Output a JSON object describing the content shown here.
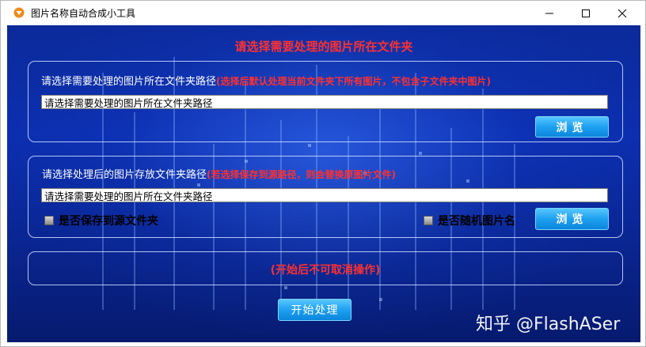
{
  "window": {
    "title": "图片名称自动合成小工具",
    "minimize_icon": "minimize-icon",
    "maximize_icon": "maximize-icon",
    "close_icon": "close-icon"
  },
  "header": {
    "title": "请选择需要处理的图片所在文件夹"
  },
  "source_group": {
    "label": "请选择需要处理的图片所在文件夹路径",
    "hint": "(选择后默认处理当前文件夹下所有图片，不包含子文件夹中图片)",
    "input_value": "请选择需要处理的图片所在文件夹路径",
    "browse_label": "浏览"
  },
  "output_group": {
    "label": "请选择处理后的图片存放文件夹路径",
    "hint": "(若选择保存到源路径，则会替换原图片文件)",
    "input_value": "请选择需要处理的图片所在文件夹路径",
    "save_to_source_label": "是否保存到源文件夹",
    "random_name_label": "是否随机图片名",
    "browse_label": "浏览"
  },
  "warning": {
    "text": "(开始后不可取消操作)"
  },
  "start_button": {
    "label": "开始处理"
  },
  "watermark": {
    "text": "知乎 @FlashASer"
  },
  "colors": {
    "accent_red": "#ff3030",
    "button_blue": "#1ea0f0",
    "panel_blue": "#0c2fb0"
  }
}
